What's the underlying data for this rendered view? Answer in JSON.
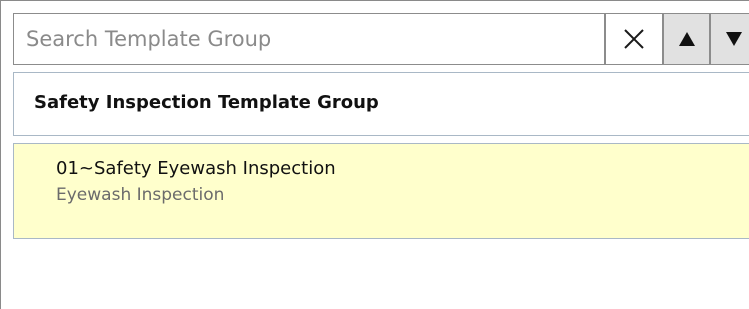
{
  "search": {
    "placeholder": "Search Template Group",
    "value": ""
  },
  "controls": {
    "clear_icon": "close-icon",
    "up_icon": "triangle-up-icon",
    "down_icon": "triangle-down-icon"
  },
  "group": {
    "title": "Safety Inspection Template Group"
  },
  "items": [
    {
      "title": "01~Safety Eyewash Inspection",
      "subtitle": "Eyewash Inspection"
    }
  ],
  "colors": {
    "item_highlight": "#ffffcc",
    "arrow_button_bg": "#e1e1e1",
    "border": "#a9b8c6"
  }
}
